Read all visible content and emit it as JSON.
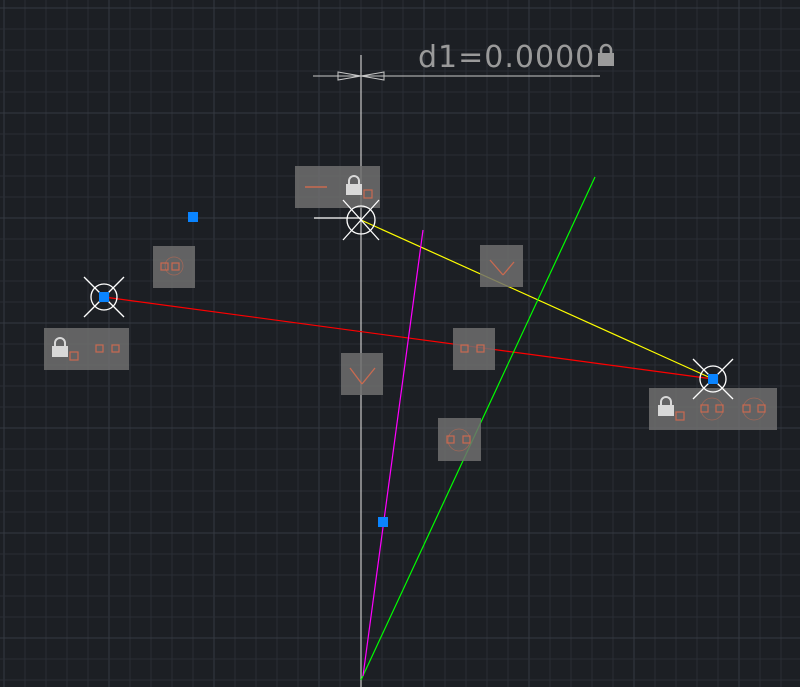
{
  "viewport": {
    "background": "#1c1f24",
    "grid_minor": "#2a2e35",
    "grid_major": "#353a42"
  },
  "dimension": {
    "label": "d1=0.0000",
    "locked": true
  },
  "colors": {
    "red_line": "#ff0000",
    "yellow_line": "#ffff00",
    "green_line": "#00ff00",
    "magenta_line": "#ff00ff",
    "grip": "#0a84ff",
    "axis": "#c8c8c8",
    "badge_bg": "#6e6e6e",
    "constraint_icon": "#c96a50"
  },
  "icons": [
    "lock-icon",
    "coincident-icon",
    "tangent-icon",
    "fix-icon",
    "crosshair-icon"
  ]
}
